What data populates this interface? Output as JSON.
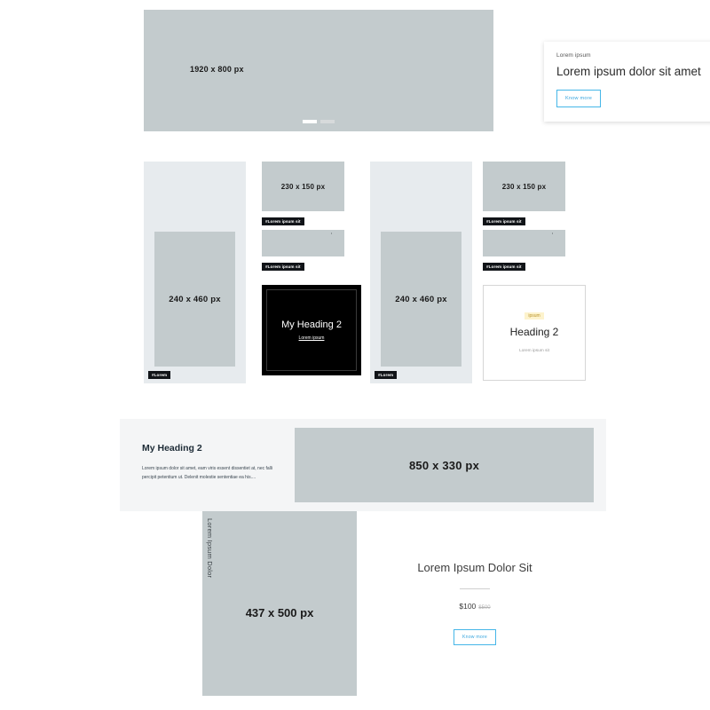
{
  "hero": {
    "image_label": "1920 x 800 px",
    "card": {
      "kicker": "Lorem ipsum",
      "title": "Lorem ipsum dolor sit amet",
      "button": "Know more"
    },
    "pagination": [
      {
        "state": "active"
      },
      {
        "state": "inactive"
      }
    ]
  },
  "grid": {
    "column_a": {
      "inner_image_label": "240 x 460 px",
      "tag": "#Lorem"
    },
    "column_b": {
      "top_image_label": "230 x 150 px",
      "tag_1": "#Lorem ipsum sit",
      "tag_2": "#Lorem ipsum sit",
      "black_card": {
        "title": "My Heading 2",
        "subtitle": "Lorem ipsum"
      }
    },
    "column_c": {
      "inner_image_label": "240 x 460 px",
      "tag": "#Lorem"
    },
    "column_d": {
      "top_image_label": "230 x 150 px",
      "tag_1": "#Lorem ipsum sit",
      "tag_2": "#Lorem ipsum sit",
      "white_card": {
        "kicker": "ipsum",
        "title": "Heading 2",
        "subtitle": "Lorem ipsum sit"
      }
    }
  },
  "band": {
    "title": "My Heading 2",
    "paragraph": "Lorem ipsum dolor sit amet, eam viris essent dissentiet at, nec falli percipit petentium ut. Delenit molestie sententiae ea his....",
    "image_label": "850 x 330 px"
  },
  "product": {
    "image_label": "437 x 500 px",
    "vertical_label": "Lorem Ipsum Dolor",
    "title": "Lorem Ipsum Dolor Sit",
    "price": "$100",
    "old_price": "$500",
    "button": "Know more"
  },
  "colors": {
    "placeholder": "#c3cbcd",
    "placeholder_light": "#e7ebee",
    "band_bg": "#f4f5f6",
    "accent_blue": "#45b6e8",
    "tag_bg": "#111418",
    "kicker_bg": "#fdf3cd",
    "kicker_text": "#b9932b"
  }
}
